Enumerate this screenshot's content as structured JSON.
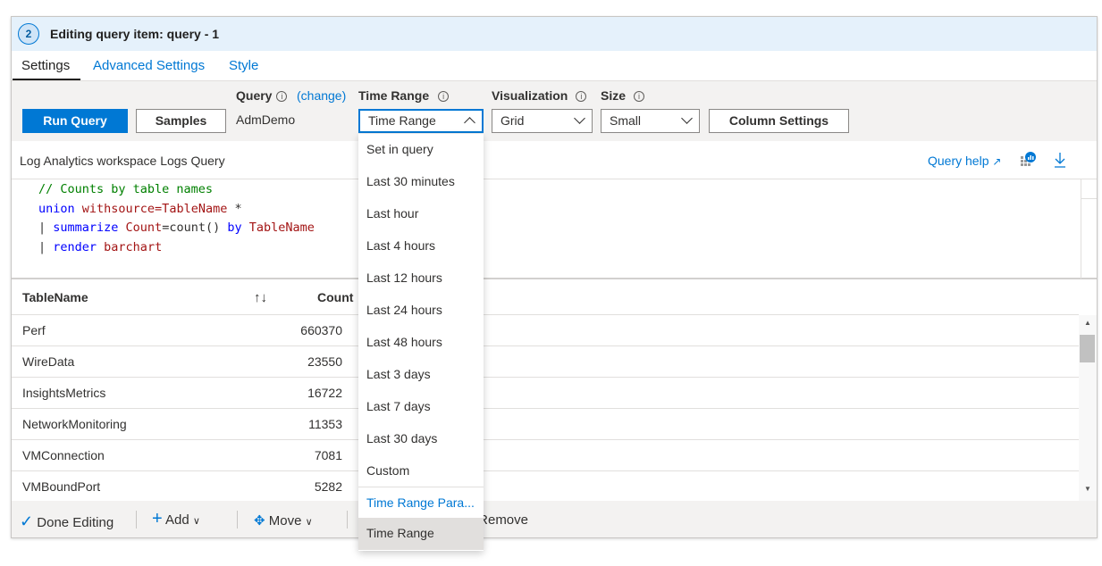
{
  "header": {
    "step": "2",
    "title": "Editing query item: query - 1"
  },
  "tabs": [
    {
      "label": "Settings",
      "active": true
    },
    {
      "label": "Advanced Settings"
    },
    {
      "label": "Style"
    }
  ],
  "toolbar": {
    "run_label": "Run Query",
    "samples_label": "Samples",
    "query_label": "Query",
    "query_change": "(change)",
    "query_value": "AdmDemo",
    "time_range_label": "Time Range",
    "time_range_value": "Time Range",
    "visualization_label": "Visualization",
    "visualization_value": "Grid",
    "size_label": "Size",
    "size_value": "Small",
    "column_settings_label": "Column Settings",
    "info_glyph": "i"
  },
  "query_area": {
    "title": "Log Analytics workspace Logs Query",
    "help_label": "Query help",
    "code": [
      [
        "// Counts by table names"
      ],
      [
        "union ",
        "withsource=TableName",
        " *"
      ],
      [
        "| ",
        "summarize ",
        "Count",
        "=count() ",
        "by ",
        "TableName"
      ],
      [
        "| ",
        "render ",
        "barchart"
      ]
    ]
  },
  "table": {
    "headers": [
      "TableName",
      "Count"
    ],
    "sort_glyph": "↑↓",
    "rows": [
      [
        "Perf",
        "660370"
      ],
      [
        "WireData",
        "23550"
      ],
      [
        "InsightsMetrics",
        "16722"
      ],
      [
        "NetworkMonitoring",
        "11353"
      ],
      [
        "VMConnection",
        "7081"
      ],
      [
        "VMBoundPort",
        "5282"
      ]
    ]
  },
  "bottom": {
    "done": "Done Editing",
    "add": "Add",
    "move": "Move",
    "remove": "Remove"
  },
  "dropdown": {
    "items": [
      "Set in query",
      "Last 30 minutes",
      "Last hour",
      "Last 4 hours",
      "Last 12 hours",
      "Last 24 hours",
      "Last 48 hours",
      "Last 3 days",
      "Last 7 days",
      "Last 30 days",
      "Custom"
    ],
    "param_header": "Time Range Para...",
    "param_item": "Time Range"
  },
  "colors": {
    "accent": "#0078d4",
    "header_bg": "#e5f1fb"
  }
}
